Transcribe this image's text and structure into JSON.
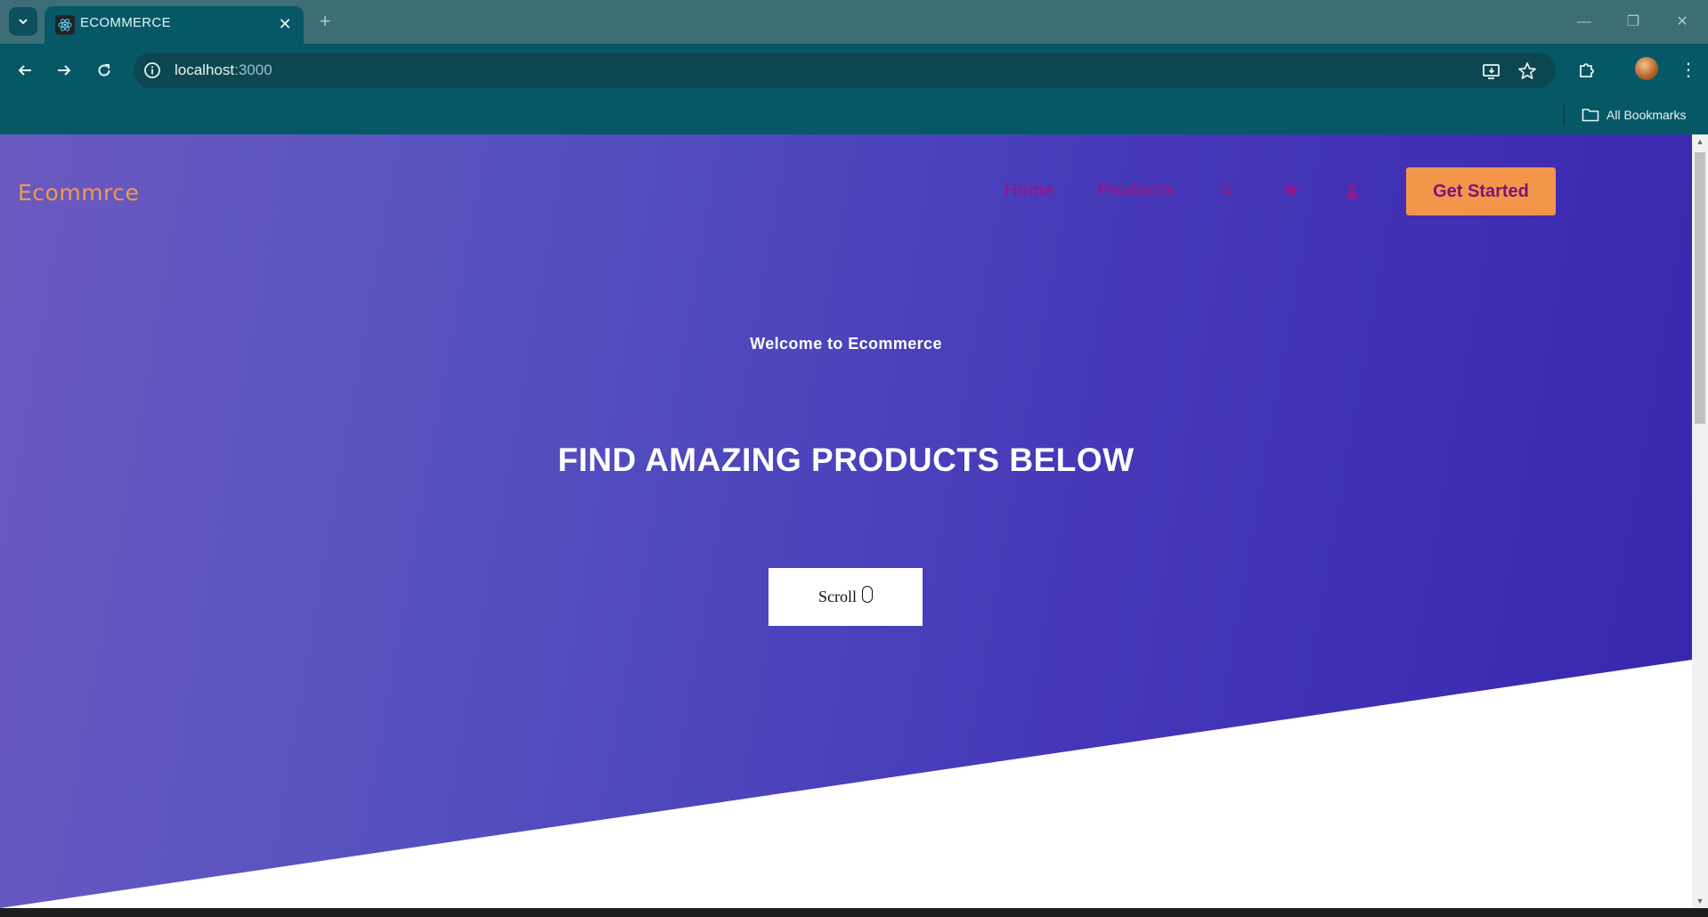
{
  "browser": {
    "tab_title": "ECOMMERCE",
    "tab_close": "✕",
    "new_tab": "+",
    "url_host": "localhost",
    "url_port": ":3000",
    "bookmarks_label": "All Bookmarks",
    "window_controls": [
      "—",
      "❐",
      "✕"
    ],
    "menu": "⋮"
  },
  "site": {
    "brand": "Ecommrce",
    "nav": {
      "home": "Home",
      "products": "Products"
    },
    "cta_label": "Get Started",
    "welcome": "Welcome to Ecommerce",
    "headline": "FIND AMAZING PRODUCTS BELOW",
    "scroll_label": "Scroll"
  },
  "colors": {
    "brand": "#f2994a",
    "nav_link": "#8b1a8f",
    "cta_bg": "#f4964a",
    "hero_start": "#6a5ac0",
    "hero_end": "#3726ae",
    "chrome_bg": "#075866"
  },
  "icons": [
    "tab-search-icon",
    "react-favicon-icon",
    "back-arrow-icon",
    "forward-arrow-icon",
    "reload-icon",
    "site-info-icon",
    "install-app-icon",
    "bookmark-star-icon",
    "extensions-icon",
    "folder-icon",
    "search-icon",
    "cart-icon",
    "user-icon",
    "mouse-icon"
  ]
}
